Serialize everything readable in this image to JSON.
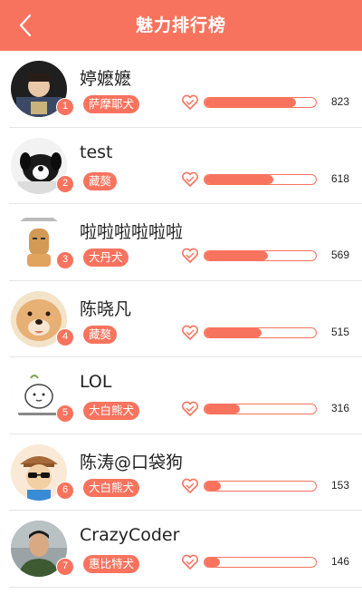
{
  "header": {
    "title": "魅力排行榜",
    "back_icon": "chevron-left-icon",
    "background": "#f8735e"
  },
  "colors": {
    "accent": "#f8735e",
    "divider": "#e6e6e6",
    "text": "#222222"
  },
  "ranking": [
    {
      "rank": "1",
      "name": "婷嬷嬷",
      "breed": "萨摩耶犬",
      "score": "823",
      "progress": 0.82
    },
    {
      "rank": "2",
      "name": "test",
      "breed": "藏獒",
      "score": "618",
      "progress": 0.62
    },
    {
      "rank": "3",
      "name": "啦啦啦啦啦啦",
      "breed": "大丹犬",
      "score": "569",
      "progress": 0.57
    },
    {
      "rank": "4",
      "name": "陈晓凡",
      "breed": "藏獒",
      "score": "515",
      "progress": 0.51
    },
    {
      "rank": "5",
      "name": "LOL",
      "breed": "大白熊犬",
      "score": "316",
      "progress": 0.32
    },
    {
      "rank": "6",
      "name": "陈涛@口袋狗",
      "breed": "大白熊犬",
      "score": "153",
      "progress": 0.15
    },
    {
      "rank": "7",
      "name": "CrazyCoder",
      "breed": "惠比特犬",
      "score": "146",
      "progress": 0.14
    }
  ]
}
